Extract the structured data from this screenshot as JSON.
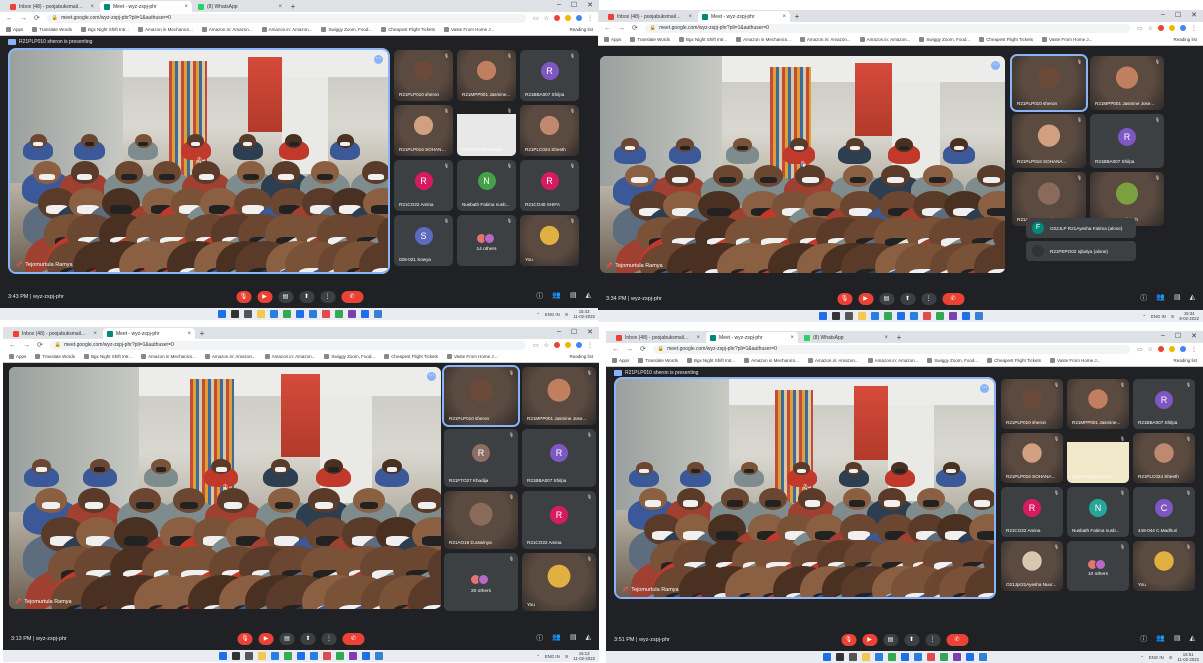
{
  "screenshots": [
    {
      "tabs": [
        {
          "label": "Inbox (48) - poojabuksmail@gmai",
          "favicon": "gmail-icon",
          "color": "#ea4335"
        },
        {
          "label": "Meet - wyz-zspj-phr",
          "favicon": "meet-icon",
          "color": "#00897b",
          "active": true
        },
        {
          "label": "(8) WhatsApp",
          "favicon": "whatsapp-icon",
          "color": "#25d366"
        }
      ],
      "url": "meet.google.com/wyz-zspj-phr?pli=1&authuser=0",
      "bookmarks": [
        "Apps",
        "Translate Words",
        "Bgx Night Shift Intr...",
        "Amazon in Mechanics...",
        "Amazon.in: Amazon...",
        "Amazon.in: Amazon...",
        "Swiggy Zoom, Food...",
        "Cheapest Flight Tickets",
        "Vaste From Home J..."
      ],
      "reading_list": "Reading list",
      "presenting": "R21PLP010 sheron is presenting",
      "main_caption": "Tejomurtula Ramya",
      "tiles": [
        {
          "name": "R21PLP010 sheron",
          "kind": "video",
          "tone": "#6b4a3a"
        },
        {
          "name": "R21MPP001 Jasmine...",
          "kind": "video",
          "tone": "#c08060"
        },
        {
          "name": "R21BBA007 Shilpa",
          "kind": "avatar",
          "initial": "R",
          "color": "#7e57c2"
        },
        {
          "name": "R21PLP016 SOHANA...",
          "kind": "video",
          "tone": "#d0a080"
        },
        {
          "name": "R21PLP010 sheron",
          "kind": "screen",
          "tone": "#e8e8e8"
        },
        {
          "name": "R21PLC024 Sheeth",
          "kind": "video",
          "tone": "#c08870"
        },
        {
          "name": "R21CO22 Amina",
          "kind": "avatar",
          "initial": "R",
          "color": "#d81b60"
        },
        {
          "name": "Nusbath Fatima nusb...",
          "kind": "avatar",
          "initial": "N",
          "color": "#43a047"
        },
        {
          "name": "R21CO48 SHIFA",
          "kind": "avatar",
          "initial": "R",
          "color": "#d81b60"
        },
        {
          "name": "028-021 Sowya",
          "kind": "avatar",
          "initial": "S",
          "color": "#5c6bc0"
        },
        {
          "name": "14 others",
          "kind": "others"
        },
        {
          "name": "You",
          "kind": "video",
          "tone": "#e0b040"
        }
      ],
      "time": "3:43 PM",
      "meeting_code": "wyz-zspj-phr",
      "tray": {
        "lang": "ENG\nIN",
        "clock_time": "15:43",
        "clock_date": "11-02-2022"
      }
    },
    {
      "tabs": [
        {
          "label": "Inbox (48) - poojabuksmail@gmai",
          "favicon": "gmail-icon",
          "color": "#ea4335"
        },
        {
          "label": "Meet - wyz-zspj-phr",
          "favicon": "meet-icon",
          "color": "#00897b",
          "active": true
        }
      ],
      "url": "meet.google.com/wyz-zspj-phr?pli=1&authuser=0",
      "bookmarks": [
        "Apps",
        "Translate Words",
        "Bgx Night Shift Intr...",
        "Amazon in Mechanics...",
        "Amazon.in: Amazon...",
        "Amazon.in: Amazon...",
        "Swiggy Zoom, Food...",
        "Cheapest Flight Tickets",
        "Vaste From Home J..."
      ],
      "reading_list": "Reading list",
      "presenting": "",
      "main_caption": "Tejomurtula Ramya",
      "tiles": [
        {
          "name": "R21PLP010 sheron",
          "kind": "video",
          "tone": "#6b4a3a",
          "active": true
        },
        {
          "name": "R21MPP001 Jasmine Jose...",
          "kind": "video",
          "tone": "#c08060"
        },
        {
          "name": "R21PLP016 SOHANA...",
          "kind": "video",
          "tone": "#d0a080"
        },
        {
          "name": "R21BBA007 Shilpa",
          "kind": "avatar",
          "initial": "R",
          "color": "#7e57c2"
        },
        {
          "name": "R21AO18 D.aswinya",
          "kind": "video",
          "tone": "#8a6a5a"
        },
        {
          "name": "R21PEPO14 Sliuhah",
          "kind": "video",
          "tone": "#7aa040"
        }
      ],
      "overlay": [
        {
          "name": "O22JLP R21Ayesha Fatima (alone)",
          "initial": "F",
          "color": "#00897b"
        },
        {
          "name": "R21PEPO02 Iqbalya (alone)",
          "initial": "",
          "color": "#333"
        }
      ],
      "time": "3:34 PM",
      "meeting_code": "wyz-zspj-phr",
      "tray": {
        "lang": "ENG\nIN",
        "clock_time": "15:34",
        "clock_date": "8-02-2022"
      }
    },
    {
      "tabs": [
        {
          "label": "Inbox (48) - poojabuksmail@gmai",
          "favicon": "gmail-icon",
          "color": "#ea4335"
        },
        {
          "label": "Meet - wyz-zspj-phr",
          "favicon": "meet-icon",
          "color": "#00897b",
          "active": true
        }
      ],
      "url": "meet.google.com/wyz-zspj-phr?pli=1&authuser=0",
      "bookmarks": [
        "Apps",
        "Translate Words",
        "Bgx Night Shift Intr...",
        "Amazon in Mechanics...",
        "Amazon.in: Amazon...",
        "Amazon.in: Amazon...",
        "Swiggy Zoom, Food...",
        "Cheapest Flight Tickets",
        "Vaste From Home J..."
      ],
      "reading_list": "Reading list",
      "presenting": "",
      "main_caption": "Tejomurtula Ramya",
      "tiles": [
        {
          "name": "R21PLP010 sheron",
          "kind": "video",
          "tone": "#6b4a3a",
          "active": true
        },
        {
          "name": "R21MPP001 Jasmine Jose...",
          "kind": "video",
          "tone": "#c08060"
        },
        {
          "name": "R21FTO27 Khadija",
          "kind": "avatar",
          "initial": "R",
          "color": "#8d6e63"
        },
        {
          "name": "R21BBA007 Shilpa",
          "kind": "avatar",
          "initial": "R",
          "color": "#7e57c2"
        },
        {
          "name": "R21AO18 D.aswinya",
          "kind": "video",
          "tone": "#8a6a5a"
        },
        {
          "name": "R21CO22 Amina",
          "kind": "avatar",
          "initial": "R",
          "color": "#d81b60"
        },
        {
          "name": "20 others",
          "kind": "others"
        },
        {
          "name": "You",
          "kind": "video",
          "tone": "#e0b040"
        }
      ],
      "time": "3:13 PM",
      "meeting_code": "wyz-zspj-phr",
      "tray": {
        "lang": "ENG\nIN",
        "clock_time": "15:13",
        "clock_date": "11-02-2022"
      }
    },
    {
      "tabs": [
        {
          "label": "Inbox (48) - poojabuksmail@gmai",
          "favicon": "gmail-icon",
          "color": "#ea4335"
        },
        {
          "label": "Meet - wyz-zspj-phr",
          "favicon": "meet-icon",
          "color": "#00897b",
          "active": true
        },
        {
          "label": "(8) WhatsApp",
          "favicon": "whatsapp-icon",
          "color": "#25d366"
        }
      ],
      "url": "meet.google.com/wyz-zspj-phr?pli=1&authuser=0",
      "bookmarks": [
        "Apps",
        "Translate Words",
        "Bgx Night Shift Intr...",
        "Amazon in Mechanics...",
        "Amazon.in: Amazon...",
        "Amazon.in: Amazon...",
        "Swiggy Zoom, Food...",
        "Cheapest Flight Tickets",
        "Vaste From Home J..."
      ],
      "reading_list": "Reading list",
      "presenting": "R21PLP010 sheron is presenting",
      "main_caption": "Tejomurtula Ramya",
      "tiles": [
        {
          "name": "R21PLP010 sheron",
          "kind": "video",
          "tone": "#6b4a3a"
        },
        {
          "name": "R21MPP001 Jasmine...",
          "kind": "video",
          "tone": "#c08060"
        },
        {
          "name": "R21BBA007 Shilpa",
          "kind": "avatar",
          "initial": "R",
          "color": "#7e57c2"
        },
        {
          "name": "R21PLP016 SOHANA...",
          "kind": "video",
          "tone": "#d0a080"
        },
        {
          "name": "R21PLP010 sheron",
          "kind": "screen",
          "tone": "#f0e8c8"
        },
        {
          "name": "R21PLC024 Sheeth",
          "kind": "video",
          "tone": "#c08870"
        },
        {
          "name": "R21CO22 Amina",
          "kind": "avatar",
          "initial": "R",
          "color": "#d81b60"
        },
        {
          "name": "Nusbath Fatima nusb...",
          "kind": "avatar",
          "initial": "N",
          "color": "#26a69a"
        },
        {
          "name": "448-044 C.Madhuri",
          "kind": "avatar",
          "initial": "C",
          "color": "#7e57c2"
        },
        {
          "name": "O21Jpr21Ayesha Nuur...",
          "kind": "video",
          "tone": "#d8c8b0"
        },
        {
          "name": "10 others",
          "kind": "others"
        },
        {
          "name": "You",
          "kind": "video",
          "tone": "#e0b040"
        }
      ],
      "time": "3:51 PM",
      "meeting_code": "wyz-zspj-phr",
      "tray": {
        "lang": "ENG\nIN",
        "clock_time": "15:51",
        "clock_date": "11-02-2022"
      }
    }
  ],
  "window_controls": [
    "–",
    "☐",
    "✕"
  ],
  "taskbar_icons": [
    "start",
    "search",
    "task-view",
    "file-explorer",
    "cortana",
    "chrome",
    "mail",
    "store",
    "store2",
    "chrome2",
    "onenote",
    "photos",
    "settings"
  ],
  "controls": {
    "mic": "mic-off-icon",
    "camera": "camera-off-icon",
    "cc": "captions-icon",
    "present": "present-icon",
    "more": "more-icon",
    "end": "end-call-icon",
    "info": "info-icon",
    "people": "people-icon",
    "chat": "chat-icon",
    "activities": "activities-icon"
  },
  "colors": {
    "meet_bg": "#202124",
    "tile_bg": "#3c4043",
    "accent": "#8ab4f8",
    "end_red": "#ea4335"
  }
}
